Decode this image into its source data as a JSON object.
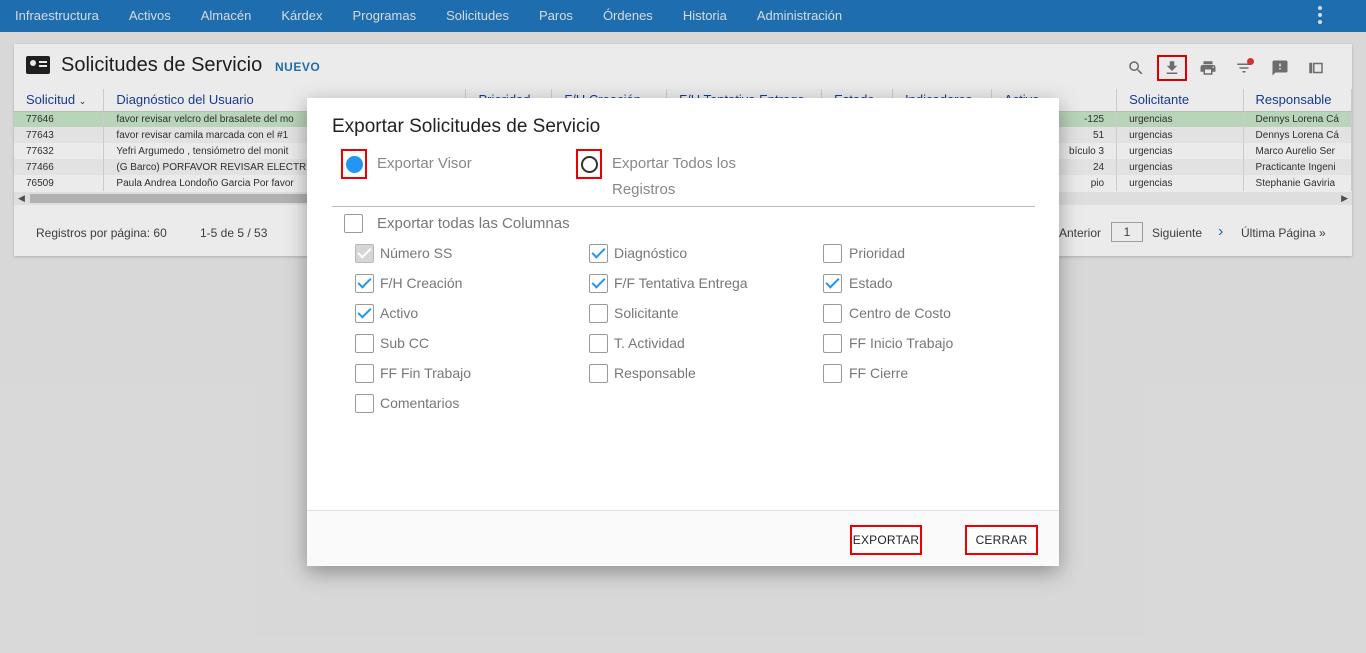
{
  "nav": [
    "Infraestructura",
    "Activos",
    "Almacén",
    "Kárdex",
    "Programas",
    "Solicitudes",
    "Paros",
    "Órdenes",
    "Historia",
    "Administración"
  ],
  "page": {
    "title": "Solicitudes de Servicio",
    "new_label": "NUEVO"
  },
  "toolbar": [
    "search-icon",
    "download-icon",
    "print-icon",
    "filter-icon",
    "feedback-icon",
    "view-columns-icon"
  ],
  "grid": {
    "headers": [
      "Solicitud",
      "Diagnóstico del Usuario",
      "Prioridad",
      "F/H Creación",
      "F/H Tentativa Entrega",
      "Estado",
      "Indicadores",
      "Activo",
      "Solicitante",
      "Responsable"
    ],
    "rows": [
      [
        "77646",
        "favor revisar velcro del brasalete del mo",
        "",
        "",
        "",
        "",
        "",
        "-125",
        "urgencias",
        "Dennys Lorena Cá"
      ],
      [
        "77643",
        "favor revisar camila marcada con el #1",
        "",
        "",
        "",
        "",
        "",
        "51",
        "urgencias",
        "Dennys Lorena Cá"
      ],
      [
        "77632",
        "Yefri Argumedo , tensiómetro del monit",
        "",
        "",
        "",
        "",
        "",
        "bículo 3",
        "urgencias",
        "Marco Aurelio Ser"
      ],
      [
        "77466",
        "(G Barco) PORFAVOR REVISAR ELECTR",
        "",
        "",
        "",
        "",
        "",
        "24",
        "urgencias",
        "Practicante Ingeni"
      ],
      [
        "76509",
        "Paula Andrea Londoño Garcia Por favor",
        "",
        "",
        "",
        "",
        "",
        "pio",
        "urgencias",
        "Stephanie Gaviria"
      ]
    ]
  },
  "pager": {
    "per_page": "Registros por página: 60",
    "range": "1-5 de 5 / 53",
    "prev": "Anterior",
    "page": "1",
    "next": "Siguiente",
    "last": "Última Página »"
  },
  "modal": {
    "title": "Exportar Solicitudes de Servicio",
    "radio_visor": "Exportar Visor",
    "radio_todos_1": "Exportar Todos los",
    "radio_todos_2": "Registros",
    "all_columns": "Exportar todas las Columnas",
    "columns": [
      {
        "label": "Número SS",
        "checked": true,
        "disabled": true
      },
      {
        "label": "Diagnóstico",
        "checked": true
      },
      {
        "label": "Prioridad",
        "checked": false
      },
      {
        "label": "F/H Creación",
        "checked": true
      },
      {
        "label": "F/F Tentativa Entrega",
        "checked": true
      },
      {
        "label": "Estado",
        "checked": true
      },
      {
        "label": "Activo",
        "checked": true
      },
      {
        "label": "Solicitante",
        "checked": false
      },
      {
        "label": "Centro de Costo",
        "checked": false
      },
      {
        "label": "Sub CC",
        "checked": false
      },
      {
        "label": "T. Actividad",
        "checked": false
      },
      {
        "label": "FF Inicio Trabajo",
        "checked": false
      },
      {
        "label": "FF Fin Trabajo",
        "checked": false
      },
      {
        "label": "Responsable",
        "checked": false
      },
      {
        "label": "FF Cierre",
        "checked": false
      },
      {
        "label": "Comentarios",
        "checked": false
      }
    ],
    "export_button": "EXPORTAR",
    "close_button": "CERRAR"
  }
}
